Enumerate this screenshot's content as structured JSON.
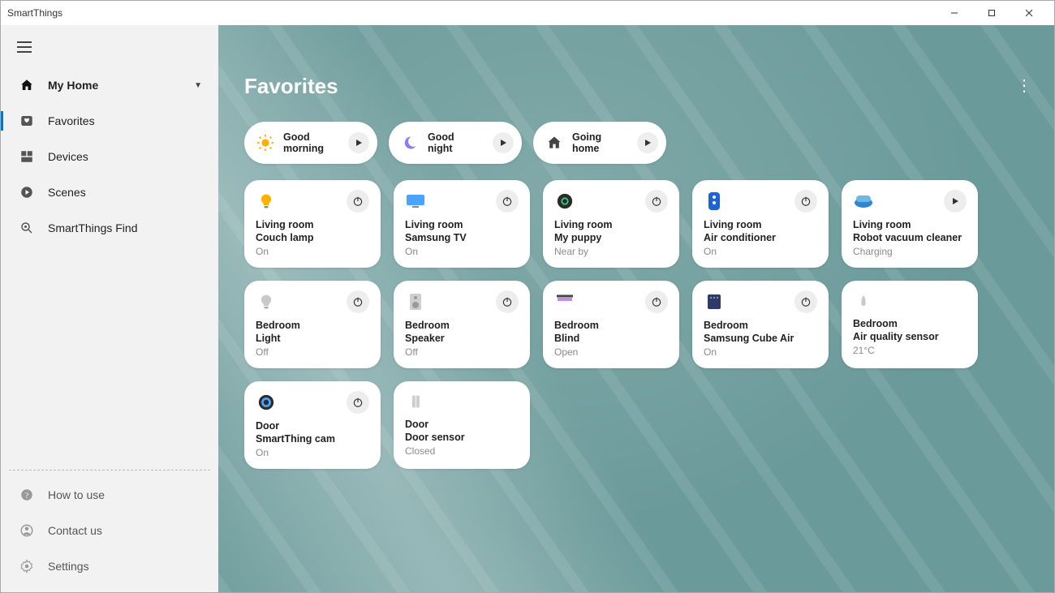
{
  "window": {
    "title": "SmartThings"
  },
  "sidebar": {
    "location": "My Home",
    "items": [
      {
        "label": "Favorites"
      },
      {
        "label": "Devices"
      },
      {
        "label": "Scenes"
      },
      {
        "label": "SmartThings Find"
      }
    ],
    "footer": [
      {
        "label": "How to use"
      },
      {
        "label": "Contact us"
      },
      {
        "label": "Settings"
      }
    ]
  },
  "page": {
    "title": "Favorites"
  },
  "scenes": [
    {
      "line1": "Good",
      "line2": "morning",
      "icon": "sun"
    },
    {
      "line1": "Good",
      "line2": "night",
      "icon": "moon"
    },
    {
      "line1": "Going",
      "line2": "home",
      "icon": "house"
    }
  ],
  "devices": [
    {
      "room": "Living room",
      "name": "Couch lamp",
      "status": "On",
      "icon": "bulb-on",
      "action": "power"
    },
    {
      "room": "Living room",
      "name": "Samsung TV",
      "status": "On",
      "icon": "tv",
      "action": "power"
    },
    {
      "room": "Living room",
      "name": "My puppy",
      "status": "Near by",
      "icon": "tag",
      "action": "power"
    },
    {
      "room": "Living room",
      "name": "Air conditioner",
      "status": "On",
      "icon": "ac",
      "action": "power"
    },
    {
      "room": "Living room",
      "name": "Robot vacuum cleaner",
      "status": "Charging",
      "icon": "robot",
      "action": "play"
    },
    {
      "room": "Bedroom",
      "name": "Light",
      "status": "Off",
      "icon": "bulb-off",
      "action": "power"
    },
    {
      "room": "Bedroom",
      "name": "Speaker",
      "status": "Off",
      "icon": "speaker",
      "action": "power"
    },
    {
      "room": "Bedroom",
      "name": "Blind",
      "status": "Open",
      "icon": "blind",
      "action": "power"
    },
    {
      "room": "Bedroom",
      "name": "Samsung Cube Air",
      "status": "On",
      "icon": "cube",
      "action": "power"
    },
    {
      "room": "Bedroom",
      "name": "Air quality sensor",
      "status": "21°C",
      "icon": "sensor",
      "action": "none"
    },
    {
      "room": "Door",
      "name": "SmartThing cam",
      "status": "On",
      "icon": "cam",
      "action": "power"
    },
    {
      "room": "Door",
      "name": "Door sensor",
      "status": "Closed",
      "icon": "door",
      "action": "none"
    }
  ]
}
